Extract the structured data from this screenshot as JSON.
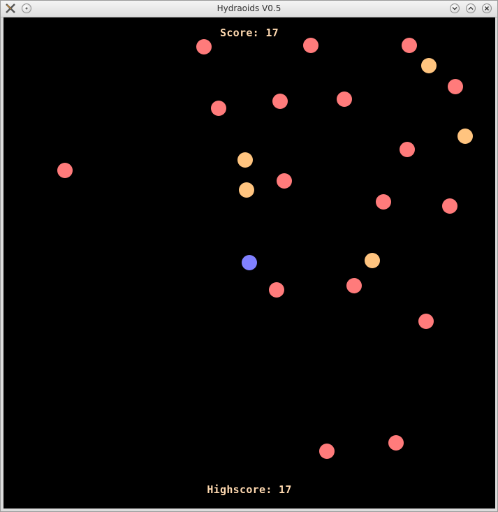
{
  "window": {
    "title": "Hydraoids V0.5",
    "app_icon": "x-logo-icon",
    "buttons": [
      "minimize-icon",
      "maximize-icon",
      "close-icon"
    ]
  },
  "hud": {
    "score_label": "Score: 17",
    "highscore_label": "Highscore: 17"
  },
  "colors": {
    "background": "#000000",
    "hud_text": "#ffd9b0",
    "enemy_red": "#ff7b7b",
    "enemy_orange": "#ffc47f",
    "player_blue": "#8080ff"
  }
}
